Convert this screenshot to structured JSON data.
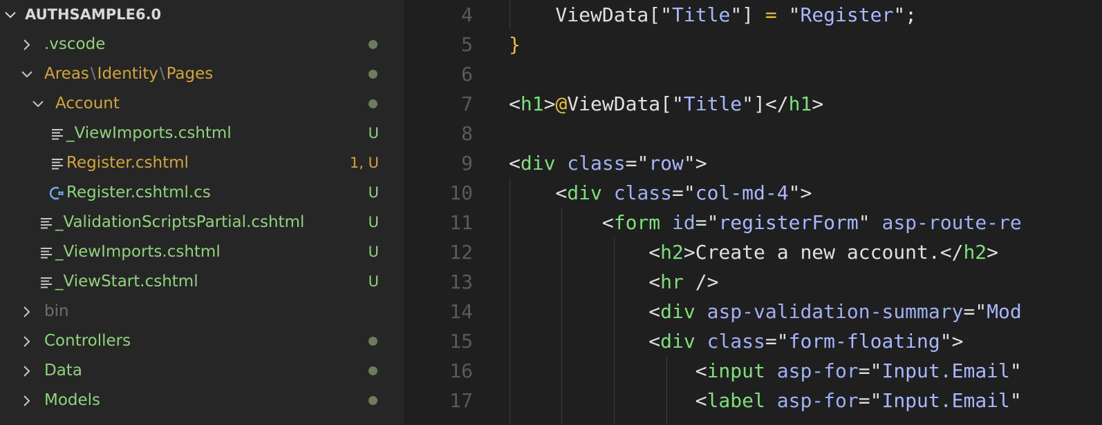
{
  "explorer": {
    "root": {
      "label": "AUTHSAMPLE6.0"
    },
    "items": [
      {
        "kind": "folder",
        "expanded": false,
        "label": ".vscode",
        "color": "green",
        "status": "dot"
      },
      {
        "kind": "folder",
        "expanded": true,
        "segments": [
          "Areas",
          "Identity",
          "Pages"
        ],
        "color": "gold",
        "status": "dot"
      },
      {
        "kind": "folder",
        "expanded": true,
        "label": "Account",
        "color": "gold",
        "status": "dot"
      },
      {
        "kind": "file",
        "icon": "lines-icon",
        "label": "_ViewImports.cshtml",
        "color": "green",
        "badge": "U"
      },
      {
        "kind": "file",
        "icon": "lines-icon",
        "label": "Register.cshtml",
        "color": "gold",
        "badge": "1, U"
      },
      {
        "kind": "file",
        "icon": "csharp-icon",
        "label": "Register.cshtml.cs",
        "color": "green",
        "badge": "U"
      },
      {
        "kind": "file",
        "icon": "lines-icon",
        "label": "_ValidationScriptsPartial.cshtml",
        "color": "green",
        "badge": "U"
      },
      {
        "kind": "file",
        "icon": "lines-icon",
        "label": "_ViewImports.cshtml",
        "color": "green",
        "badge": "U"
      },
      {
        "kind": "file",
        "icon": "lines-icon",
        "label": "_ViewStart.cshtml",
        "color": "green",
        "badge": "U"
      },
      {
        "kind": "folder",
        "expanded": false,
        "label": "bin",
        "color": "dim",
        "status": ""
      },
      {
        "kind": "folder",
        "expanded": false,
        "label": "Controllers",
        "color": "green",
        "status": "dot"
      },
      {
        "kind": "folder",
        "expanded": false,
        "label": "Data",
        "color": "green",
        "status": "dot"
      },
      {
        "kind": "folder",
        "expanded": false,
        "label": "Models",
        "color": "green",
        "status": "dot"
      }
    ]
  },
  "editor": {
    "lines": [
      {
        "number": "4",
        "tokens": [
          [
            "punc",
            "    ViewData[\""
          ],
          [
            "str",
            "Title"
          ],
          [
            "punc",
            "\"] "
          ],
          [
            "eq",
            "="
          ],
          [
            "punc",
            " \""
          ],
          [
            "str",
            "Register"
          ],
          [
            "punc",
            "\";"
          ]
        ]
      },
      {
        "number": "5",
        "tokens": [
          [
            "brace",
            "}"
          ]
        ]
      },
      {
        "number": "6",
        "tokens": []
      },
      {
        "number": "7",
        "tokens": [
          [
            "punc",
            "<"
          ],
          [
            "tag",
            "h1"
          ],
          [
            "punc",
            ">"
          ],
          [
            "at",
            "@"
          ],
          [
            "punc",
            "ViewData[\""
          ],
          [
            "str",
            "Title"
          ],
          [
            "punc",
            "\"]</"
          ],
          [
            "tag",
            "h1"
          ],
          [
            "punc",
            ">"
          ]
        ]
      },
      {
        "number": "8",
        "tokens": []
      },
      {
        "number": "9",
        "tokens": [
          [
            "punc",
            "<"
          ],
          [
            "tag",
            "div"
          ],
          [
            "punc",
            " "
          ],
          [
            "attr",
            "class"
          ],
          [
            "punc",
            "=\""
          ],
          [
            "str",
            "row"
          ],
          [
            "punc",
            "\">"
          ]
        ]
      },
      {
        "number": "10",
        "tokens": [
          [
            "punc",
            "    <"
          ],
          [
            "tag",
            "div"
          ],
          [
            "punc",
            " "
          ],
          [
            "attr",
            "class"
          ],
          [
            "punc",
            "=\""
          ],
          [
            "str",
            "col-md-4"
          ],
          [
            "punc",
            "\">"
          ]
        ]
      },
      {
        "number": "11",
        "tokens": [
          [
            "punc",
            "        <"
          ],
          [
            "tag",
            "form"
          ],
          [
            "punc",
            " "
          ],
          [
            "attr",
            "id"
          ],
          [
            "punc",
            "=\""
          ],
          [
            "str",
            "registerForm"
          ],
          [
            "punc",
            "\" "
          ],
          [
            "attr",
            "asp-route-re"
          ]
        ]
      },
      {
        "number": "12",
        "tokens": [
          [
            "punc",
            "            <"
          ],
          [
            "tag",
            "h2"
          ],
          [
            "punc",
            ">Create a new account.</"
          ],
          [
            "tag",
            "h2"
          ],
          [
            "punc",
            ">"
          ]
        ]
      },
      {
        "number": "13",
        "tokens": [
          [
            "punc",
            "            <"
          ],
          [
            "tag",
            "hr"
          ],
          [
            "punc",
            " />"
          ]
        ]
      },
      {
        "number": "14",
        "tokens": [
          [
            "punc",
            "            <"
          ],
          [
            "tag",
            "div"
          ],
          [
            "punc",
            " "
          ],
          [
            "attr",
            "asp-validation-summary"
          ],
          [
            "punc",
            "=\""
          ],
          [
            "str",
            "Mod"
          ]
        ]
      },
      {
        "number": "15",
        "tokens": [
          [
            "punc",
            "            <"
          ],
          [
            "tag",
            "div"
          ],
          [
            "punc",
            " "
          ],
          [
            "attr",
            "class"
          ],
          [
            "punc",
            "=\""
          ],
          [
            "str",
            "form-floating"
          ],
          [
            "punc",
            "\">"
          ]
        ]
      },
      {
        "number": "16",
        "tokens": [
          [
            "punc",
            "                <"
          ],
          [
            "tag",
            "input"
          ],
          [
            "punc",
            " "
          ],
          [
            "attr",
            "asp-for"
          ],
          [
            "punc",
            "=\""
          ],
          [
            "str",
            "Input.Email"
          ],
          [
            "punc",
            "\""
          ]
        ]
      },
      {
        "number": "17",
        "tokens": [
          [
            "punc",
            "                <"
          ],
          [
            "tag",
            "label"
          ],
          [
            "punc",
            " "
          ],
          [
            "attr",
            "asp-for"
          ],
          [
            "punc",
            "=\""
          ],
          [
            "str",
            "Input.Email"
          ],
          [
            "punc",
            "\""
          ]
        ]
      }
    ]
  }
}
